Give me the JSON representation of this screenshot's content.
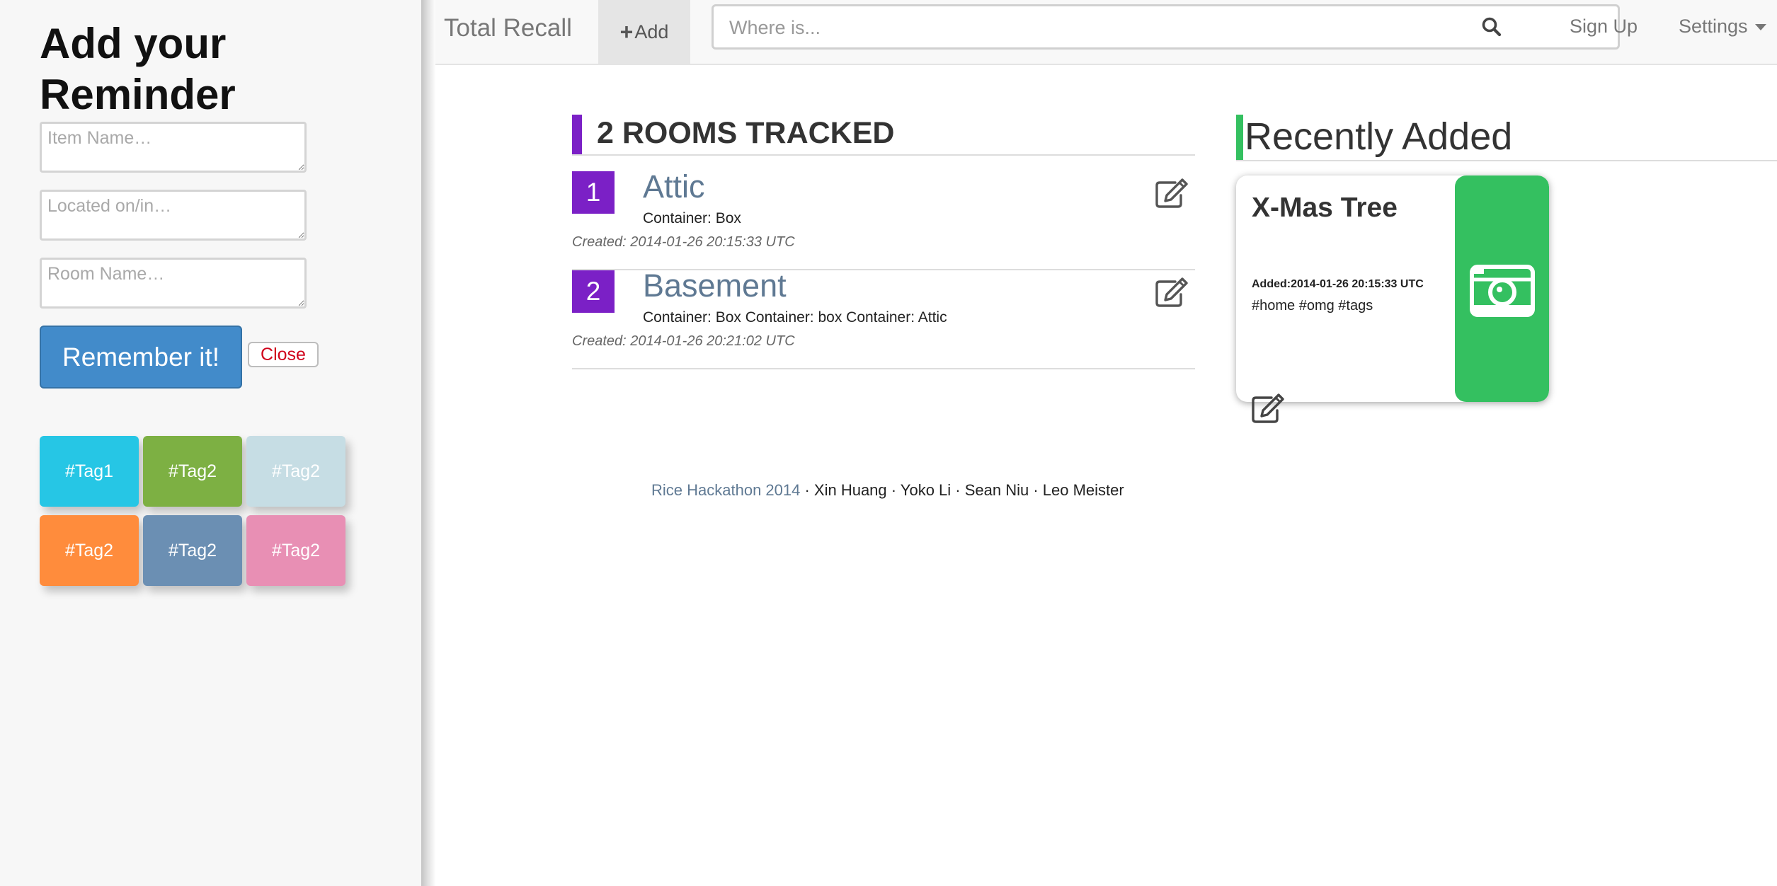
{
  "sidebar": {
    "title": "Add your Reminder",
    "fields": {
      "item_placeholder": "Item Name…",
      "location_placeholder": "Located on/in…",
      "room_placeholder": "Room Name…"
    },
    "remember_label": "Remember it!",
    "close_label": "Close",
    "tags": [
      {
        "label": "#Tag1",
        "color": "#26c6e5"
      },
      {
        "label": "#Tag2",
        "color": "#7db043"
      },
      {
        "label": "#Tag2",
        "color": "#c6dde4"
      },
      {
        "label": "#Tag2",
        "color": "#ff8c3c"
      },
      {
        "label": "#Tag2",
        "color": "#6b8fb3"
      },
      {
        "label": "#Tag2",
        "color": "#e88fb4"
      }
    ]
  },
  "navbar": {
    "brand": "Total Recall",
    "add_label": "Add",
    "search_placeholder": "Where is...",
    "signup_label": "Sign Up",
    "settings_label": "Settings"
  },
  "rooms": {
    "heading": "2 ROOMS TRACKED",
    "accent_color": "#7b20c6",
    "items": [
      {
        "number": "1",
        "name": "Attic",
        "containers": "Container: Box",
        "created": "Created: 2014-01-26 20:15:33 UTC"
      },
      {
        "number": "2",
        "name": "Basement",
        "containers": "Container: Box Container: box Container: Attic",
        "created": "Created: 2014-01-26 20:21:02 UTC"
      }
    ]
  },
  "recent": {
    "heading": "Recently Added",
    "accent_color": "#34c060",
    "card": {
      "name": "X-Mas Tree",
      "added_label": "Added:",
      "added_value": "2014-01-26 20:15:33 UTC",
      "tags": "#home #omg #tags",
      "icon": "camera-icon"
    }
  },
  "footer": {
    "link": "Rice Hackathon 2014",
    "names": " · Xin Huang · Yoko Li · Sean Niu · Leo Meister"
  }
}
